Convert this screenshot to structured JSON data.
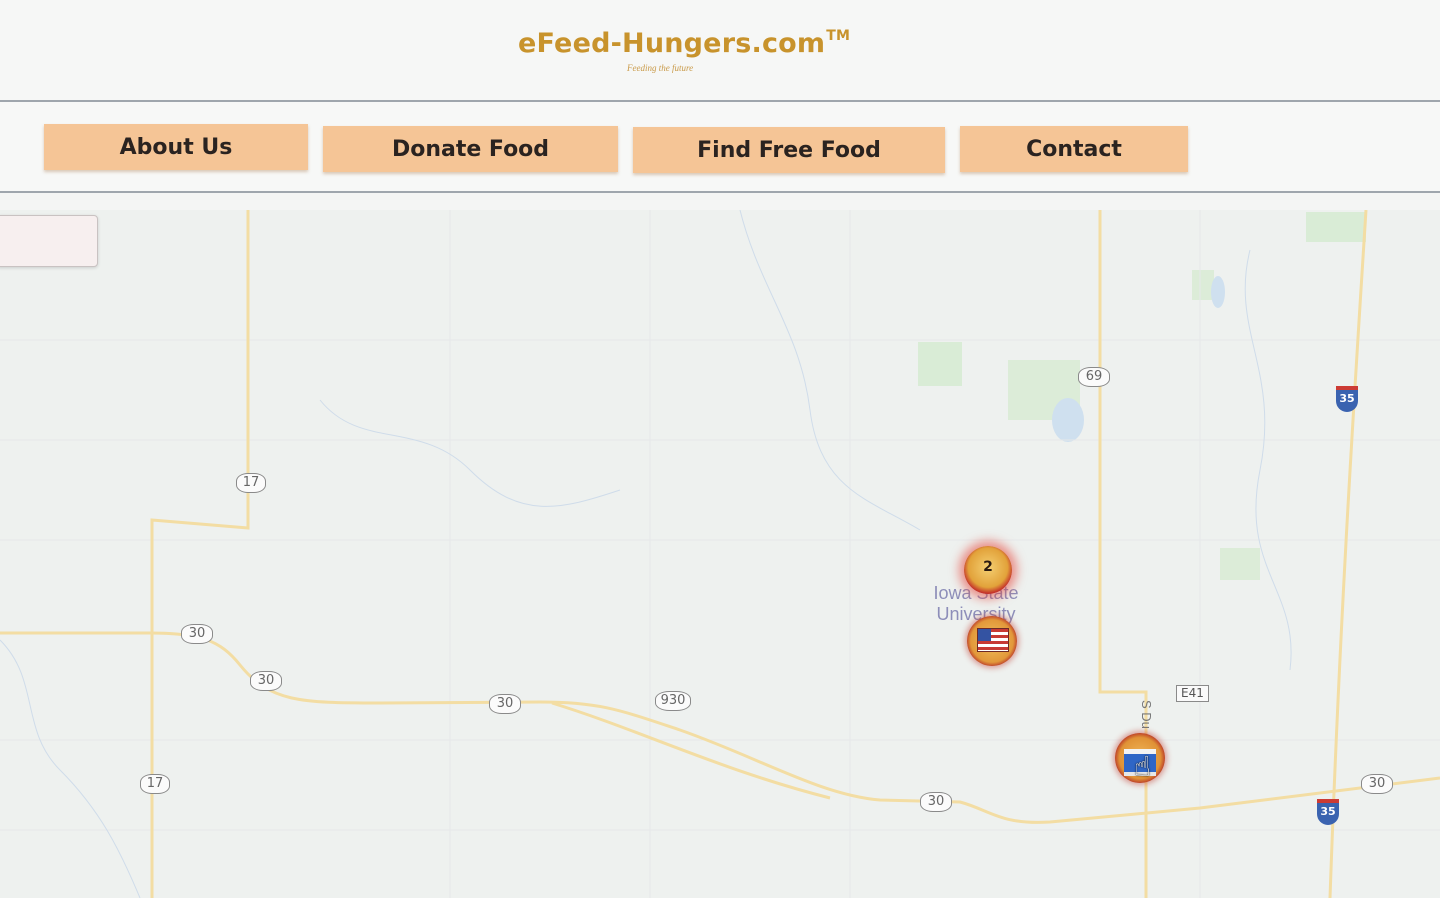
{
  "header": {
    "logo_text": "eFeed-Hungers.com",
    "logo_tm": "TM",
    "tagline": "Feeding the future"
  },
  "nav": {
    "items": [
      {
        "label": "About Us"
      },
      {
        "label": "Donate Food"
      },
      {
        "label": "Find Free Food"
      },
      {
        "label": "Contact"
      }
    ]
  },
  "map": {
    "route_shields": [
      "17",
      "30",
      "30",
      "30",
      "930",
      "30",
      "17",
      "69",
      "30"
    ],
    "interstate_shields": [
      "35",
      "35"
    ],
    "county_road": "E41",
    "place_label_line1": "Iowa State",
    "place_label_line2": "University",
    "street_label": "S Du",
    "cluster_count": "2",
    "marker_icons": [
      "us-flag-icon",
      "bus-icon"
    ],
    "colors": {
      "nav_button": "#f5c596",
      "logo": "#c8932c",
      "marker_ring": "#c4302a",
      "marker_fill": "#e2a23a"
    }
  }
}
